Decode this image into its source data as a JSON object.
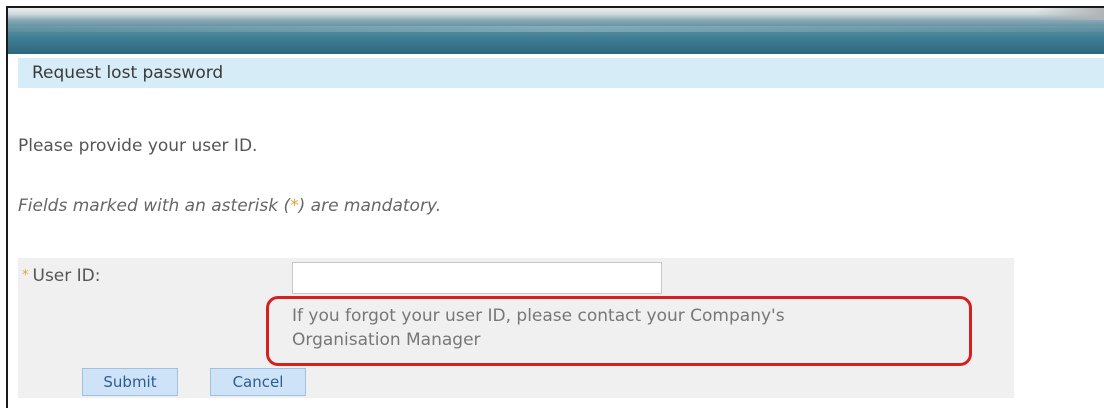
{
  "section": {
    "title": "Request lost password"
  },
  "page": {
    "intro": "Please provide your user ID.",
    "mandatory_prefix": "Fields marked with an asterisk (",
    "asterisk": "*",
    "mandatory_suffix": ") are mandatory."
  },
  "form": {
    "user_id_label": "User ID:",
    "required_marker": "*",
    "user_id_value": "",
    "hint_line1": "If you forgot your user ID, please contact your Company's",
    "hint_line2": "Organisation Manager"
  },
  "buttons": {
    "submit": "Submit",
    "cancel": "Cancel"
  },
  "colors": {
    "header_band": "#2d6780",
    "section_header_bg": "#d6ecf7",
    "form_panel_bg": "#f0f0f0",
    "asterisk": "#e8a23c",
    "highlight_border": "#d62020",
    "button_bg": "#cfe3f8"
  }
}
